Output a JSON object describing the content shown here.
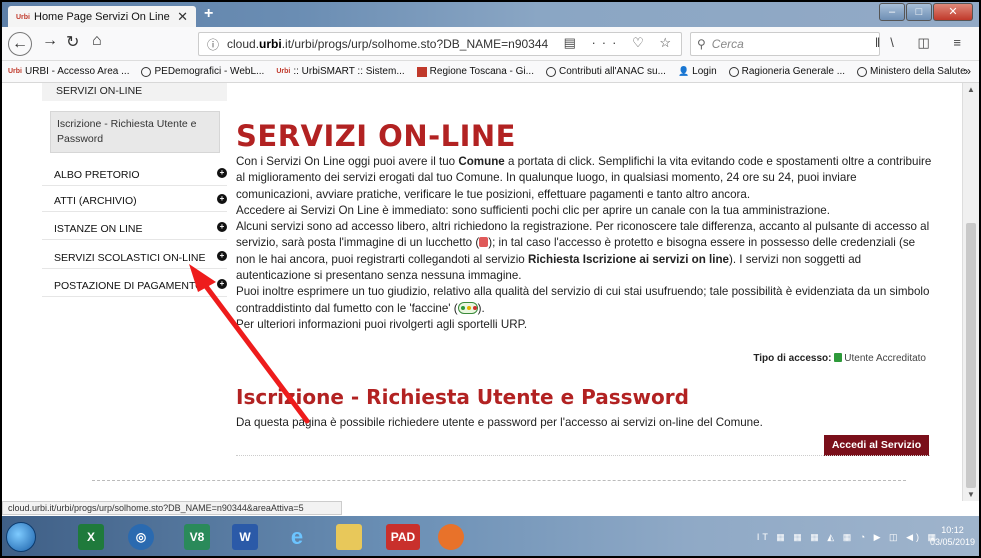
{
  "browser": {
    "tab_title": "Home Page Servizi On Line",
    "tab_logo": "Urbi",
    "url_prefix": "cloud.",
    "url_host": "urbi",
    "url_rest": ".it/urbi/progs/urp/solhome.sto?DB_NAME=n90344",
    "search_placeholder": "Cerca",
    "status_url": "cloud.urbi.it/urbi/progs/urp/solhome.sto?DB_NAME=n90344&areaAttiva=5"
  },
  "bookmarks": [
    {
      "icon": "urbi-icon",
      "label": "URBI - Accesso Area ..."
    },
    {
      "icon": "globe-icon",
      "label": "PEDemografici - WebL..."
    },
    {
      "icon": "urbi-icon",
      "label": ":: UrbiSMART :: Sistem..."
    },
    {
      "icon": "red-square-icon",
      "label": "Regione Toscana - Gi..."
    },
    {
      "icon": "globe-icon",
      "label": "Contributi all'ANAC su..."
    },
    {
      "icon": "user-icon",
      "label": "Login"
    },
    {
      "icon": "globe-icon",
      "label": "Ragioneria Generale ..."
    },
    {
      "icon": "globe-icon",
      "label": "Ministero della Salute"
    }
  ],
  "sidebar": {
    "top_label": "SERVIZI ON-LINE",
    "sub_label": "Iscrizione - Richiesta Utente e Password",
    "items": [
      {
        "label": "ALBO PRETORIO"
      },
      {
        "label": "ATTI (ARCHIVIO)"
      },
      {
        "label": "ISTANZE ON LINE"
      },
      {
        "label": "SERVIZI SCOLASTICI ON-LINE"
      },
      {
        "label": "POSTAZIONE DI PAGAMENTO"
      }
    ]
  },
  "main": {
    "title": "SERVIZI ON-LINE",
    "p1_a": "Con i Servizi On Line oggi puoi avere il tuo ",
    "p1_b": "Comune",
    "p1_c": " a portata di click. Semplifichi la vita evitando code e spostamenti oltre a contribuire al miglioramento dei servizi erogati dal tuo Comune. In qualunque luogo, in qualsiasi momento, 24 ore su 24, puoi inviare comunicazioni, avviare pratiche, verificare le tue posizioni, effettuare pagamenti e tanto altro ancora.",
    "p2": "Accedere ai Servizi On Line è immediato: sono sufficienti pochi clic per aprire un canale con la tua amministrazione.",
    "p3_a": "Alcuni servizi sono ad accesso libero, altri richiedono la registrazione. Per riconoscere tale differenza, accanto al pulsante di accesso al servizio, sarà posta l'immagine di un lucchetto (",
    "p3_b": "); in tal caso l'accesso è protetto e bisogna essere in possesso delle credenziali (se non le hai ancora, puoi registrarti collegandoti al servizio ",
    "p3_c": "Richiesta Iscrizione ai servizi on line",
    "p3_d": "). I servizi non soggetti ad autenticazione si presentano senza nessuna immagine.",
    "p4_a": "Puoi inoltre esprimere un tuo giudizio, relativo alla qualità del servizio di cui stai usufruendo; tale possibilità è evidenziata da un simbolo contraddistinto dal fumetto con le 'faccine' (",
    "p4_b": ").",
    "p5": "Per ulteriori informazioni puoi rivolgerti agli sportelli URP.",
    "tipo_label": "Tipo di accesso:",
    "tipo_value": "Utente Accreditato",
    "section_title": "Iscrizione - Richiesta Utente e Password",
    "section_desc": "Da questa pagina è possibile richiedere utente e password per l'accesso ai servizi on-line del Comune.",
    "accedi_label": "Accedi al Servizio"
  },
  "taskbar": {
    "icons": [
      "windows-start-icon",
      "excel-icon",
      "network-icon",
      "v8-icon",
      "word-icon",
      "ie-icon",
      "folder-icon",
      "pad-icon",
      "firefox-icon"
    ],
    "v8_label": "V8",
    "word_label": "W",
    "ie_label": "e",
    "pad_label": "PAD",
    "lang": "IT",
    "time": "10:12",
    "date": "03/05/2019"
  }
}
